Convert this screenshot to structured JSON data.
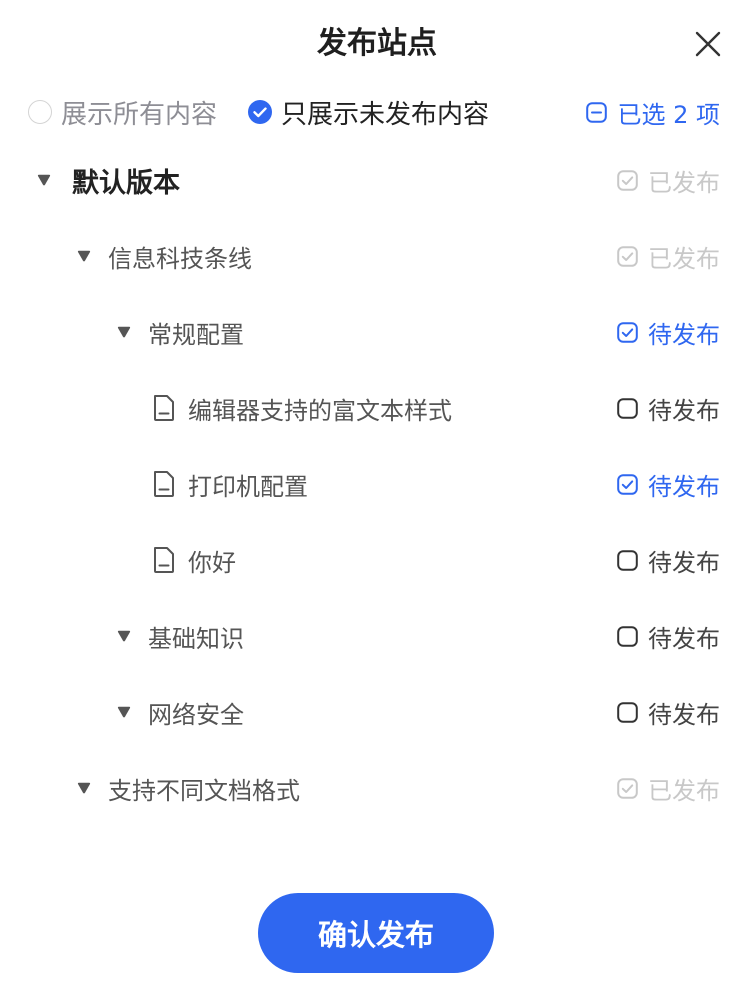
{
  "dialog": {
    "title": "发布站点",
    "close_icon": "close-icon"
  },
  "filter": {
    "options": [
      {
        "label": "展示所有内容",
        "selected": false
      },
      {
        "label": "只展示未发布内容",
        "selected": true
      }
    ],
    "selected_count_text": "已选 2 项"
  },
  "colors": {
    "accent": "#2f67f0",
    "published": "#c8c8c8",
    "text": "#555555"
  },
  "tree": [
    {
      "label": "默认版本",
      "level": 0,
      "type": "folder",
      "status": "已发布",
      "state": "published"
    },
    {
      "label": "信息科技条线",
      "level": 1,
      "type": "folder",
      "status": "已发布",
      "state": "published"
    },
    {
      "label": "常规配置",
      "level": 2,
      "type": "folder",
      "status": "待发布",
      "state": "checked"
    },
    {
      "label": "编辑器支持的富文本样式",
      "level": 3,
      "type": "doc",
      "status": "待发布",
      "state": "unchecked"
    },
    {
      "label": "打印机配置",
      "level": 3,
      "type": "doc",
      "status": "待发布",
      "state": "checked"
    },
    {
      "label": "你好",
      "level": 3,
      "type": "doc",
      "status": "待发布",
      "state": "unchecked"
    },
    {
      "label": "基础知识",
      "level": 2,
      "type": "folder",
      "status": "待发布",
      "state": "unchecked"
    },
    {
      "label": "网络安全",
      "level": 2,
      "type": "folder",
      "status": "待发布",
      "state": "unchecked"
    },
    {
      "label": "支持不同文档格式",
      "level": 1,
      "type": "folder",
      "status": "已发布",
      "state": "published"
    }
  ],
  "actions": {
    "confirm_label": "确认发布"
  }
}
